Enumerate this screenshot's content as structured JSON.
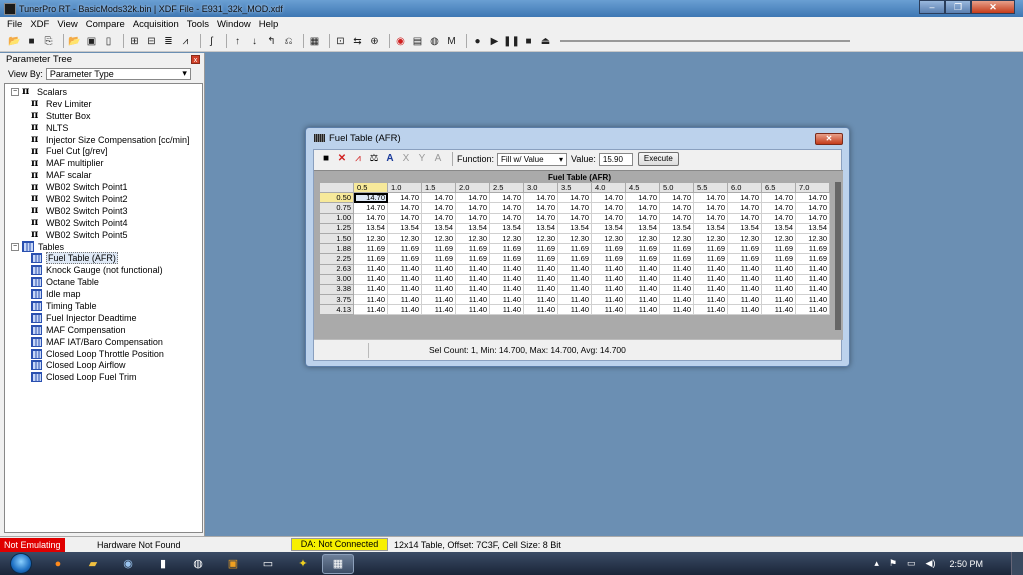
{
  "window": {
    "title": "TunerPro RT - BasicMods32k.bin | XDF File - E931_32k_MOD.xdf",
    "min_glyph": "–",
    "max_glyph": "❐",
    "close_glyph": "✕"
  },
  "menu": [
    "File",
    "XDF",
    "View",
    "Compare",
    "Acquisition",
    "Tools",
    "Window",
    "Help"
  ],
  "toolbar": {
    "icons": [
      "open-icon",
      "save-icon",
      "open-xdf-icon",
      "open-bin-icon",
      "save-bin-icon",
      "new-icon",
      "compare-icon",
      "table-icon",
      "view-icon",
      "graph-icon",
      "wand-icon",
      "up-icon",
      "down-icon",
      "left-icon",
      "history-icon",
      "hex-icon",
      "parameters-icon",
      "transfer-icon",
      "plugin-icon",
      "emulate-icon",
      "dashboard-icon",
      "globe-icon",
      "macro-icon",
      "record-icon",
      "play-icon",
      "pause-icon",
      "stop-icon",
      "eject-icon"
    ],
    "macro_label": "M"
  },
  "parameter_tree": {
    "title": "Parameter Tree",
    "close_glyph": "x",
    "view_by_label": "View By:",
    "view_by_value": "Parameter Type",
    "scalars_label": "Scalars",
    "scalars": [
      "Rev Limiter",
      "Stutter Box",
      "NLTS",
      "Injector Size Compensation [cc/min]",
      "Fuel Cut [g/rev]",
      "MAF multiplier",
      "MAF scalar",
      "WB02 Switch Point1",
      "WB02 Switch Point2",
      "WB02 Switch Point3",
      "WB02 Switch Point4",
      "WB02 Switch Point5"
    ],
    "tables_label": "Tables",
    "tables": [
      "Fuel Table (AFR)",
      "Knock Gauge (not functional)",
      "Octane Table",
      "Idle map",
      "Timing Table",
      "Fuel Injector Deadtime",
      "MAF Compensation",
      "MAF IAT/Baro Compensation",
      "Closed Loop Throttle Position",
      "Closed Loop Airflow",
      "Closed Loop Fuel Trim"
    ],
    "selected_table": "Fuel Table (AFR)"
  },
  "fuel_window": {
    "title": "Fuel Table (AFR)",
    "close_glyph": "✕",
    "function_label": "Function:",
    "function_value": "Fill w/ Value",
    "value_label": "Value:",
    "value_input": "15.90",
    "execute_label": "Execute",
    "table_title": "Fuel Table (AFR)",
    "status": "Sel Count: 1, Min: 14.700, Max: 14.700, Avg: 14.700",
    "tool_icons": [
      "save-icon",
      "close-x-icon",
      "graph-icon",
      "balance-icon",
      "text-a-icon",
      "text-x-icon",
      "text-y-icon",
      "text-a2-icon"
    ]
  },
  "table": {
    "columns": [
      "0.5",
      "1.0",
      "1.5",
      "2.0",
      "2.5",
      "3.0",
      "3.5",
      "4.0",
      "4.5",
      "5.0",
      "5.5",
      "6.0",
      "6.5",
      "7.0"
    ],
    "rows": [
      {
        "label": "0.50",
        "value": "14.70"
      },
      {
        "label": "0.75",
        "value": "14.70"
      },
      {
        "label": "1.00",
        "value": "14.70"
      },
      {
        "label": "1.25",
        "value": "13.54"
      },
      {
        "label": "1.50",
        "value": "12.30"
      },
      {
        "label": "1.88",
        "value": "11.69"
      },
      {
        "label": "2.25",
        "value": "11.69"
      },
      {
        "label": "2.63",
        "value": "11.40"
      },
      {
        "label": "3.00",
        "value": "11.40"
      },
      {
        "label": "3.38",
        "value": "11.40"
      },
      {
        "label": "3.75",
        "value": "11.40"
      },
      {
        "label": "4.13",
        "value": "11.40"
      }
    ],
    "selected_row": 0,
    "selected_col": 0
  },
  "statusbar": {
    "emulation": "Not Emulating",
    "hardware": "Hardware Not Found",
    "da": "DA: Not Connected",
    "info": "12x14 Table, Offset: 7C3F, Cell Size: 8 Bit",
    "emulation_color": "#e00000",
    "da_color": "#f7f000"
  },
  "taskbar": {
    "time": "2:50 PM",
    "tasks": [
      "firefox-icon",
      "explorer-icon",
      "app-icon",
      "notes-icon",
      "settings-icon",
      "media-icon",
      "terminal-icon",
      "runner-icon",
      "tunerpro-icon"
    ]
  }
}
